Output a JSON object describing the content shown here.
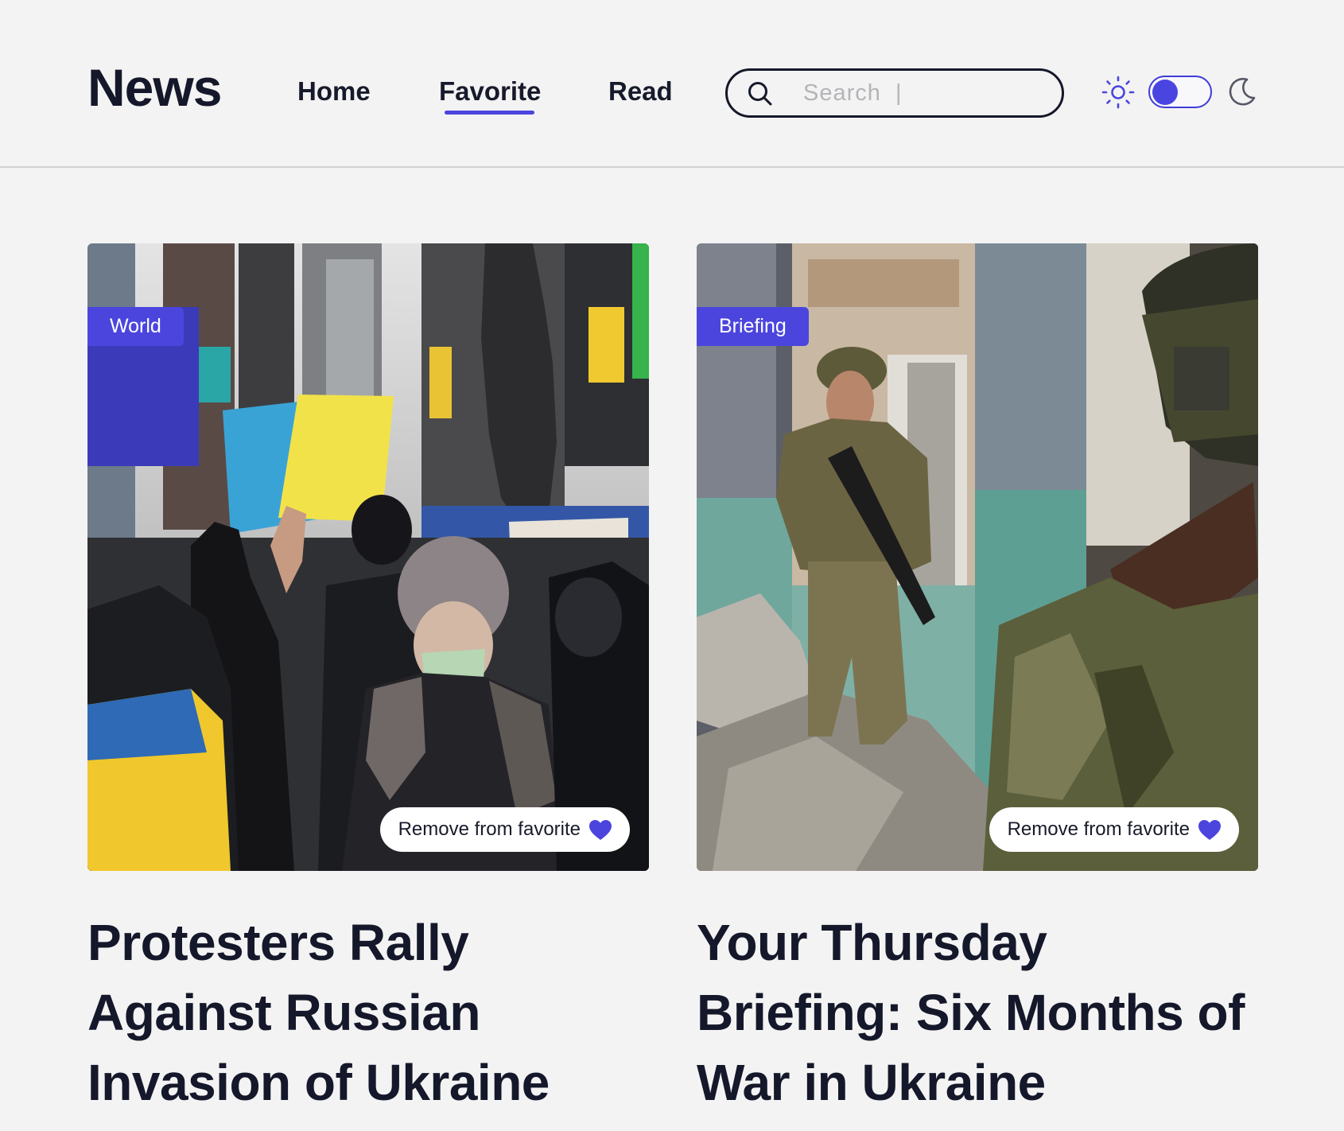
{
  "header": {
    "logo": "News",
    "nav": [
      {
        "label": "Home"
      },
      {
        "label": "Favorite",
        "active": true
      },
      {
        "label": "Read"
      }
    ],
    "search": {
      "placeholder": "Search  |",
      "value": ""
    },
    "theme": {
      "sun_icon": "sun-icon",
      "moon_icon": "moon-icon",
      "dark_mode": false
    }
  },
  "cards": [
    {
      "category": "World",
      "fav_label": "Remove from favorite",
      "title": "Protesters Rally Against Russian Invasion of Ukraine",
      "image_alt": "Protesters with Ukrainian flag in Times Square"
    },
    {
      "category": "Briefing",
      "fav_label": "Remove from favorite",
      "title": "Your Thursday Briefing: Six Months of War in Ukraine",
      "image_alt": "Ukrainian soldiers in a damaged building"
    }
  ],
  "colors": {
    "accent": "#4b45de",
    "text": "#15182a",
    "background": "#f3f3f3"
  }
}
